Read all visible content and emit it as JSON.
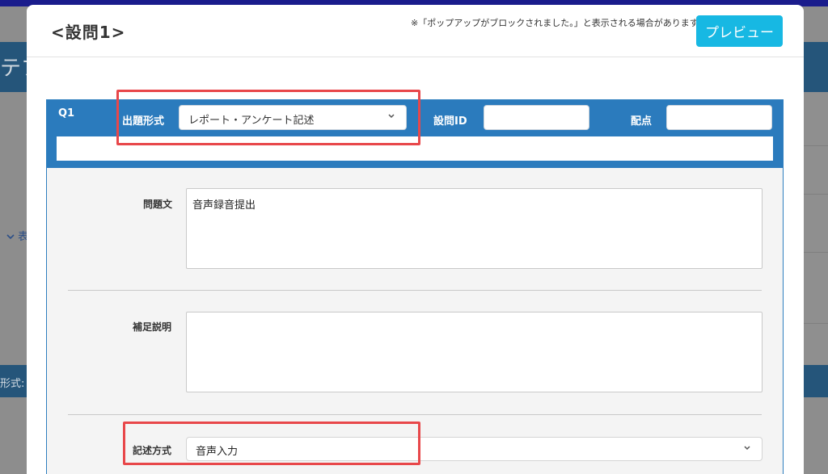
{
  "background": {
    "title_fragment": "テブ",
    "link_fragment": "表",
    "band_label_fragment": "形式:"
  },
  "modal": {
    "title": "<設問1>",
    "popup_note": "※「ポップアップがブロックされました。」と表示される場合があります。",
    "preview_label": "プレビュー"
  },
  "question": {
    "number": "Q1",
    "type_label": "出題形式",
    "type_value": "レポート・アンケート記述",
    "id_label": "設問ID",
    "id_value": "",
    "score_label": "配点",
    "score_value": "",
    "body_label": "問題文",
    "body_value": "音声録音提出",
    "supplement_label": "補足説明",
    "supplement_value": "",
    "method_label": "記述方式",
    "method_value": "音声入力"
  },
  "colors": {
    "header_blue": "#2b7bbd",
    "preview_button": "#17b8e3",
    "highlight": "#e8474a"
  },
  "icons": {
    "select_chevron": "chevron-down-icon",
    "link_chevron": "chevron-down-icon"
  }
}
